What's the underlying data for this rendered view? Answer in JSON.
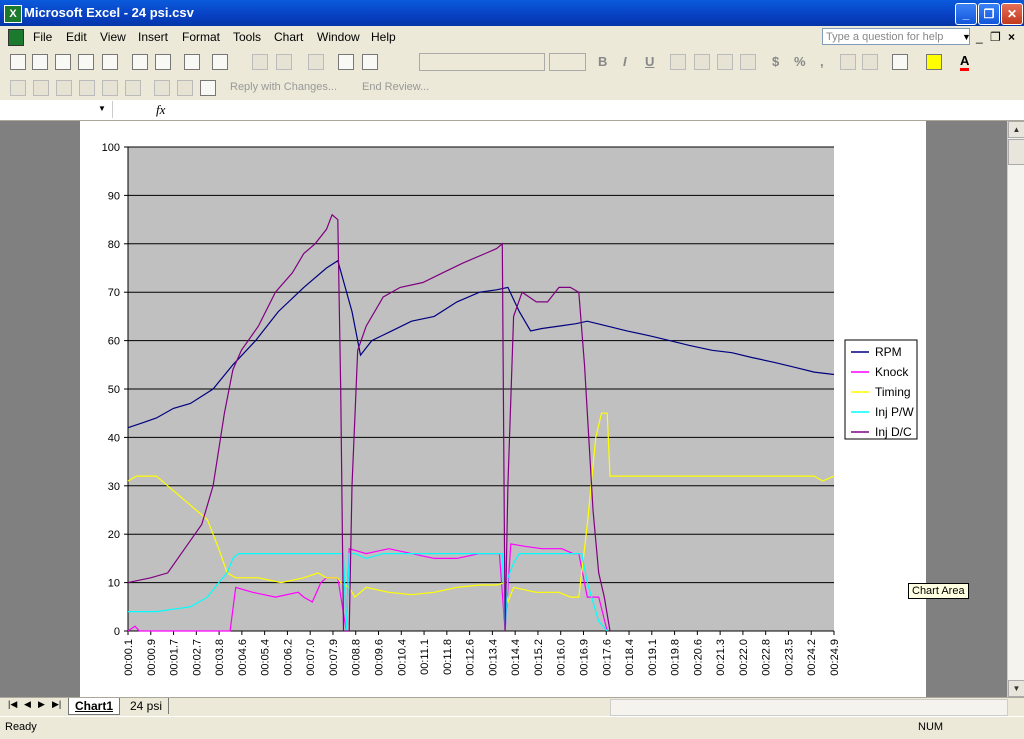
{
  "window": {
    "title": "Microsoft Excel - 24 psi.csv",
    "app_icon": "X",
    "minimize": "_",
    "restore": "❐",
    "close": "✕"
  },
  "menu": {
    "items": [
      "File",
      "Edit",
      "View",
      "Insert",
      "Format",
      "Tools",
      "Chart",
      "Window",
      "Help"
    ],
    "help_placeholder": "Type a question for help"
  },
  "reviewing": {
    "reply": "Reply with Changes...",
    "end": "End Review..."
  },
  "formula_bar": {
    "fx": "fx"
  },
  "tabs": {
    "active": "Chart1",
    "other": "24 psi"
  },
  "status": {
    "ready": "Ready",
    "num": "NUM"
  },
  "tooltip": "Chart Area",
  "colors": {
    "rpm": "#000080",
    "knock": "#ff00ff",
    "timing": "#ffff00",
    "injpw": "#00ffff",
    "injdc": "#800080",
    "plot_bg": "#c0c0c0",
    "accent": "#0a5bdc"
  },
  "chart_data": {
    "type": "line",
    "ylim": [
      0,
      100
    ],
    "yticks": [
      0,
      10,
      20,
      30,
      40,
      50,
      60,
      70,
      80,
      90,
      100
    ],
    "grid": true,
    "legend": "right",
    "x_labels": [
      "00:00.1",
      "00:00.9",
      "00:01.7",
      "00:02.7",
      "00:03.8",
      "00:04.6",
      "00:05.4",
      "00:06.2",
      "00:07.0",
      "00:07.9",
      "00:08.8",
      "00:09.6",
      "00:10.4",
      "00:11.1",
      "00:11.8",
      "00:12.6",
      "00:13.4",
      "00:14.4",
      "00:15.2",
      "00:16.0",
      "00:16.9",
      "00:17.6",
      "00:18.4",
      "00:19.1",
      "00:19.8",
      "00:20.6",
      "00:21.3",
      "00:22.0",
      "00:22.8",
      "00:23.5",
      "00:24.2",
      "00:24.9"
    ],
    "series": [
      {
        "name": "RPM",
        "color_key": "rpm",
        "points": [
          [
            0.0,
            42
          ],
          [
            0.5,
            43
          ],
          [
            1.0,
            44
          ],
          [
            1.6,
            46
          ],
          [
            2.2,
            47
          ],
          [
            3.0,
            50
          ],
          [
            3.7,
            55
          ],
          [
            4.5,
            60
          ],
          [
            5.3,
            66
          ],
          [
            6.2,
            71
          ],
          [
            7.0,
            75
          ],
          [
            7.4,
            76.5
          ],
          [
            7.9,
            66
          ],
          [
            8.2,
            57
          ],
          [
            8.6,
            60
          ],
          [
            9.3,
            62
          ],
          [
            10.0,
            64
          ],
          [
            10.8,
            65
          ],
          [
            11.6,
            68
          ],
          [
            12.4,
            70
          ],
          [
            13.0,
            70.5
          ],
          [
            13.4,
            71
          ],
          [
            13.8,
            66
          ],
          [
            14.2,
            62
          ],
          [
            14.6,
            62.5
          ],
          [
            15.2,
            63
          ],
          [
            15.8,
            63.5
          ],
          [
            16.2,
            64
          ],
          [
            16.9,
            63
          ],
          [
            17.6,
            62
          ],
          [
            18.4,
            61
          ],
          [
            19.1,
            60
          ],
          [
            19.8,
            59
          ],
          [
            20.6,
            58
          ],
          [
            21.3,
            57.5
          ],
          [
            22.0,
            56.5
          ],
          [
            22.8,
            55.5
          ],
          [
            23.5,
            54.5
          ],
          [
            24.2,
            53.5
          ],
          [
            24.9,
            53
          ]
        ]
      },
      {
        "name": "Knock",
        "color_key": "knock",
        "points": [
          [
            0.0,
            0
          ],
          [
            0.25,
            1
          ],
          [
            0.4,
            0
          ],
          [
            3.6,
            0
          ],
          [
            3.8,
            9
          ],
          [
            4.4,
            8
          ],
          [
            5.2,
            7
          ],
          [
            6.0,
            8
          ],
          [
            6.2,
            7
          ],
          [
            6.5,
            6
          ],
          [
            6.8,
            10
          ],
          [
            7.0,
            11
          ],
          [
            7.4,
            11
          ],
          [
            7.7,
            0
          ],
          [
            7.8,
            17
          ],
          [
            8.4,
            16
          ],
          [
            9.2,
            17
          ],
          [
            10.0,
            16
          ],
          [
            10.8,
            15
          ],
          [
            11.6,
            15
          ],
          [
            12.4,
            16
          ],
          [
            13.1,
            16
          ],
          [
            13.3,
            0
          ],
          [
            13.5,
            18
          ],
          [
            14.0,
            17.5
          ],
          [
            14.6,
            17
          ],
          [
            15.3,
            17
          ],
          [
            15.7,
            16
          ],
          [
            15.9,
            16
          ],
          [
            16.2,
            7
          ],
          [
            16.6,
            7
          ],
          [
            16.9,
            0
          ]
        ]
      },
      {
        "name": "Timing",
        "color_key": "timing",
        "points": [
          [
            0.0,
            31
          ],
          [
            0.3,
            32
          ],
          [
            1.0,
            32
          ],
          [
            1.4,
            30
          ],
          [
            2.0,
            27
          ],
          [
            2.8,
            23
          ],
          [
            3.2,
            17
          ],
          [
            3.5,
            12
          ],
          [
            3.8,
            11
          ],
          [
            4.6,
            11
          ],
          [
            5.4,
            10
          ],
          [
            6.2,
            11
          ],
          [
            6.7,
            12
          ],
          [
            7.0,
            11
          ],
          [
            7.4,
            11
          ],
          [
            7.5,
            10
          ],
          [
            7.8,
            9
          ],
          [
            8.0,
            7
          ],
          [
            8.4,
            9
          ],
          [
            9.2,
            8
          ],
          [
            10.0,
            7.5
          ],
          [
            10.8,
            8
          ],
          [
            11.6,
            9
          ],
          [
            12.4,
            9.5
          ],
          [
            13.0,
            9.5
          ],
          [
            13.3,
            10
          ],
          [
            13.4,
            6
          ],
          [
            13.6,
            9
          ],
          [
            14.4,
            8
          ],
          [
            15.2,
            8
          ],
          [
            15.6,
            7
          ],
          [
            15.9,
            7
          ],
          [
            16.2,
            22
          ],
          [
            16.5,
            40
          ],
          [
            16.7,
            45
          ],
          [
            16.9,
            45
          ],
          [
            17.0,
            32
          ],
          [
            18.4,
            32
          ],
          [
            20.6,
            32
          ],
          [
            22.8,
            32
          ],
          [
            24.2,
            32
          ],
          [
            24.5,
            31
          ],
          [
            24.9,
            32
          ]
        ]
      },
      {
        "name": "Inj P/W",
        "color_key": "injpw",
        "points": [
          [
            0.0,
            4
          ],
          [
            1.0,
            4
          ],
          [
            1.6,
            4.5
          ],
          [
            2.2,
            5
          ],
          [
            2.8,
            7
          ],
          [
            3.2,
            10
          ],
          [
            3.5,
            12
          ],
          [
            3.7,
            15
          ],
          [
            3.9,
            16
          ],
          [
            7.4,
            16
          ],
          [
            7.6,
            16
          ],
          [
            7.7,
            0
          ],
          [
            7.8,
            16
          ],
          [
            8.0,
            16
          ],
          [
            8.4,
            15
          ],
          [
            9.0,
            16
          ],
          [
            13.1,
            16
          ],
          [
            13.2,
            16
          ],
          [
            13.3,
            0
          ],
          [
            13.4,
            11
          ],
          [
            13.6,
            14
          ],
          [
            13.8,
            16
          ],
          [
            15.8,
            16
          ],
          [
            16.0,
            16
          ],
          [
            16.2,
            10
          ],
          [
            16.6,
            2
          ],
          [
            16.9,
            0
          ]
        ]
      },
      {
        "name": "Inj D/C",
        "color_key": "injdc",
        "points": [
          [
            0.0,
            10
          ],
          [
            0.8,
            11
          ],
          [
            1.4,
            12
          ],
          [
            2.0,
            17
          ],
          [
            2.6,
            22
          ],
          [
            3.0,
            30
          ],
          [
            3.4,
            45
          ],
          [
            3.7,
            54
          ],
          [
            4.0,
            58
          ],
          [
            4.6,
            63
          ],
          [
            5.2,
            70
          ],
          [
            5.8,
            74
          ],
          [
            6.2,
            78
          ],
          [
            6.6,
            80
          ],
          [
            7.0,
            83
          ],
          [
            7.2,
            86
          ],
          [
            7.4,
            85
          ],
          [
            7.5,
            50
          ],
          [
            7.6,
            0
          ],
          [
            7.8,
            0
          ],
          [
            7.9,
            30
          ],
          [
            8.1,
            58
          ],
          [
            8.4,
            63
          ],
          [
            9.0,
            69
          ],
          [
            9.6,
            71
          ],
          [
            10.4,
            72
          ],
          [
            11.1,
            74
          ],
          [
            11.8,
            76
          ],
          [
            12.6,
            78
          ],
          [
            13.0,
            79
          ],
          [
            13.2,
            80
          ],
          [
            13.3,
            0
          ],
          [
            13.4,
            30
          ],
          [
            13.6,
            65
          ],
          [
            13.9,
            70
          ],
          [
            14.4,
            68
          ],
          [
            14.8,
            68
          ],
          [
            15.2,
            71
          ],
          [
            15.6,
            71
          ],
          [
            15.9,
            70
          ],
          [
            16.1,
            55
          ],
          [
            16.4,
            25
          ],
          [
            16.6,
            12
          ],
          [
            16.8,
            7
          ],
          [
            17.0,
            0
          ]
        ]
      }
    ]
  }
}
